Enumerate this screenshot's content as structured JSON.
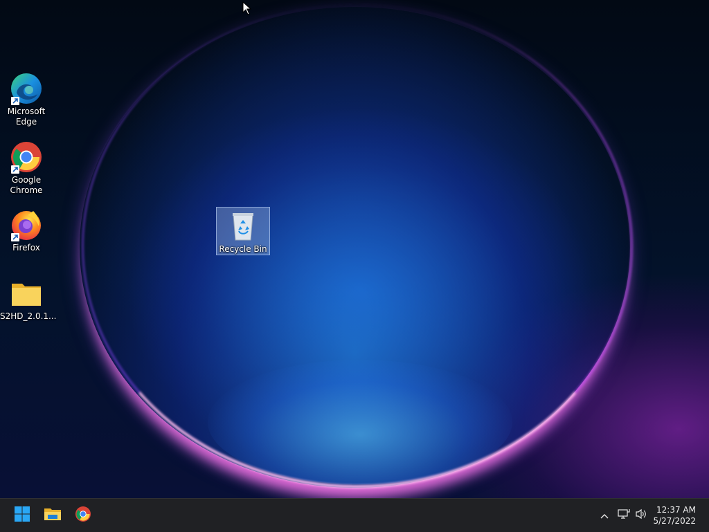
{
  "desktop": {
    "icons": [
      {
        "label": "Microsoft\nEdge",
        "icon": "edge-icon",
        "shortcut": true
      },
      {
        "label": "Google\nChrome",
        "icon": "chrome-icon",
        "shortcut": true
      },
      {
        "label": "Firefox",
        "icon": "firefox-icon",
        "shortcut": true
      },
      {
        "label": "S2HD_2.0.1...",
        "icon": "folder-icon",
        "shortcut": false
      },
      {
        "label": "Recycle Bin",
        "icon": "recycle-bin-icon",
        "selected": true
      }
    ]
  },
  "taskbar": {
    "pinned": [
      {
        "name": "Start",
        "icon": "windows-start-icon"
      },
      {
        "name": "File Explorer",
        "icon": "file-explorer-icon"
      },
      {
        "name": "Google Chrome",
        "icon": "chrome-icon"
      }
    ],
    "tray": {
      "overflow_icon": "chevron-up-icon",
      "network_icon": "network-icon",
      "volume_icon": "volume-icon"
    },
    "clock": {
      "time": "12:37 AM",
      "date": "5/27/2022"
    }
  },
  "colors": {
    "taskbar_bg": "#202124",
    "accent_blue": "#0078d4",
    "folder_yellow": "#f5c842"
  }
}
